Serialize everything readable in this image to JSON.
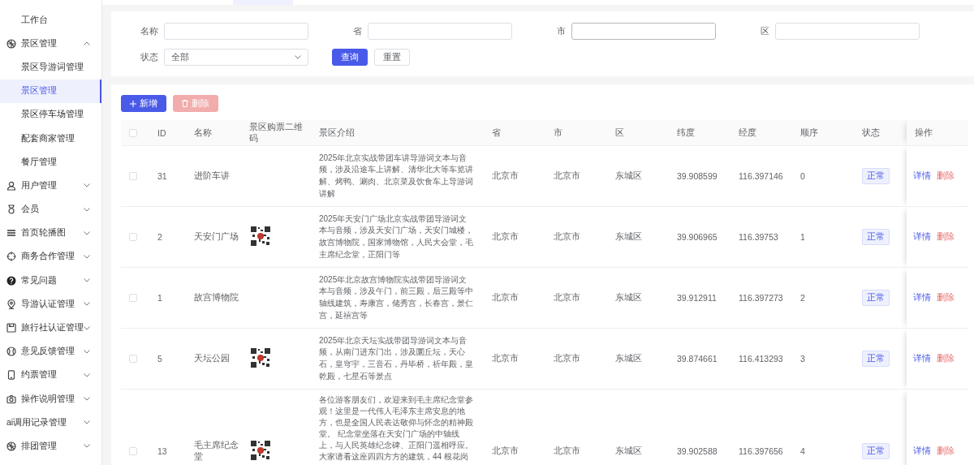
{
  "sidebar": {
    "items": [
      {
        "label": "工作台",
        "kind": "link",
        "selected": false
      },
      {
        "label": "景区管理",
        "kind": "group",
        "expanded": true,
        "children": [
          {
            "label": "景区导游词管理",
            "selected": false
          },
          {
            "label": "景区管理",
            "selected": true
          },
          {
            "label": "景区停车场管理",
            "selected": false
          },
          {
            "label": "配套商家管理",
            "selected": false
          },
          {
            "label": "餐厅管理",
            "selected": false
          }
        ]
      },
      {
        "label": "用户管理",
        "kind": "group",
        "expanded": false
      },
      {
        "label": "会员",
        "kind": "group",
        "expanded": false
      },
      {
        "label": "首页轮播图",
        "kind": "group",
        "expanded": false
      },
      {
        "label": "商务合作管理",
        "kind": "group",
        "expanded": false
      },
      {
        "label": "常见问题",
        "kind": "group",
        "expanded": false
      },
      {
        "label": "导游认证管理",
        "kind": "group",
        "expanded": false
      },
      {
        "label": "旅行社认证管理",
        "kind": "group",
        "expanded": false
      },
      {
        "label": "意见反馈管理",
        "kind": "group",
        "expanded": false
      },
      {
        "label": "约票管理",
        "kind": "group",
        "expanded": false
      },
      {
        "label": "操作说明管理",
        "kind": "group",
        "expanded": false
      },
      {
        "label": "ai调用记录管理",
        "kind": "group",
        "expanded": false
      },
      {
        "label": "排团管理",
        "kind": "group",
        "expanded": false
      }
    ]
  },
  "filters": {
    "fields": [
      {
        "label": "名称",
        "kind": "input",
        "focused": false
      },
      {
        "label": "省",
        "kind": "input",
        "focused": false
      },
      {
        "label": "市",
        "kind": "input",
        "focused": true
      },
      {
        "label": "区",
        "kind": "input",
        "focused": false
      },
      {
        "label": "状态",
        "kind": "select",
        "value": "全部",
        "focused": false
      }
    ],
    "buttons": [
      {
        "label": "查询",
        "kind": "primary"
      },
      {
        "label": "重置",
        "kind": "default"
      }
    ]
  },
  "toolbar": {
    "buttons": [
      {
        "label": "新增",
        "kind": "add",
        "disabled": false
      },
      {
        "label": "删除",
        "kind": "delete",
        "disabled": true
      }
    ]
  },
  "table": {
    "select_all": {
      "checked": false
    },
    "columns": [
      "ID",
      "名称",
      "景区购票二维码",
      "景区介绍",
      "省",
      "市",
      "区",
      "纬度",
      "经度",
      "顺序",
      "状态",
      "操作"
    ],
    "rows": [
      {
        "checked": false,
        "id": "31",
        "name": "进阶车讲",
        "qr_code": false,
        "intro": "2025年北京实战带团车讲导游词文本与音频，涉及沿途车上讲解、清华北大等车览讲解、烤鸭、涮肉、北京菜及饮食车上导游词讲解",
        "province": "北京市",
        "city": "北京市",
        "district": "东城区",
        "latitude": "39.908599",
        "longitude": "116.397146",
        "order": "0",
        "status": "正常",
        "actions": [
          {
            "label": "详情",
            "kind": "detail"
          },
          {
            "label": "删除",
            "kind": "delete"
          }
        ]
      },
      {
        "checked": false,
        "id": "2",
        "name": "天安门广场",
        "qr_code": true,
        "intro": "2025年天安门广场北京实战带团导游词文本与音频，涉及天安门广场，天安门城楼，故宫博物院，国家博物馆，人民大会堂，毛主席纪念堂，正阳门等",
        "province": "北京市",
        "city": "北京市",
        "district": "东城区",
        "latitude": "39.906965",
        "longitude": "116.39753",
        "order": "1",
        "status": "正常",
        "actions": [
          {
            "label": "详情",
            "kind": "detail"
          },
          {
            "label": "删除",
            "kind": "delete"
          }
        ]
      },
      {
        "checked": false,
        "id": "1",
        "name": "故宫博物院",
        "qr_code": false,
        "intro": "2025年北京故宫博物院实战带团导游词文本与音频，涉及午门，前三殿，后三殿等中轴线建筑，寿康宫，储秀宫，长春宫，景仁宫，延禧宫等",
        "province": "北京市",
        "city": "北京市",
        "district": "东城区",
        "latitude": "39.912911",
        "longitude": "116.397273",
        "order": "2",
        "status": "正常",
        "actions": [
          {
            "label": "详情",
            "kind": "detail"
          },
          {
            "label": "删除",
            "kind": "delete"
          }
        ]
      },
      {
        "checked": false,
        "id": "5",
        "name": "天坛公园",
        "qr_code": true,
        "intro": "2025年北京天坛实战带团导游词文本与音频，从南门进东门出，涉及圜丘坛，天心石，皇穹宇，三音石，丹毕桥，祈年殿，皇乾殿，七星石等景点",
        "province": "北京市",
        "city": "北京市",
        "district": "东城区",
        "latitude": "39.874661",
        "longitude": "116.413293",
        "order": "3",
        "status": "正常",
        "actions": [
          {
            "label": "详情",
            "kind": "detail"
          },
          {
            "label": "删除",
            "kind": "delete"
          }
        ]
      },
      {
        "checked": false,
        "id": "13",
        "name": "毛主席纪念堂",
        "qr_code": true,
        "intro": "各位游客朋友们，欢迎来到毛主席纪念堂参观！这里是一代伟人毛泽东主席安息的地方，也是全国人民表达敬仰与怀念的精神殿堂。 纪念堂坐落在天安门广场的中轴线上，与人民英雄纪念碑、正阳门遥相呼应。大家请看这座四四方方的建筑，44 根花岗",
        "province": "北京市",
        "city": "北京市",
        "district": "东城区",
        "latitude": "39.902588",
        "longitude": "116.397656",
        "order": "4",
        "status": "正常",
        "actions": [
          {
            "label": "详情",
            "kind": "detail"
          },
          {
            "label": "删除",
            "kind": "delete"
          }
        ]
      }
    ]
  }
}
